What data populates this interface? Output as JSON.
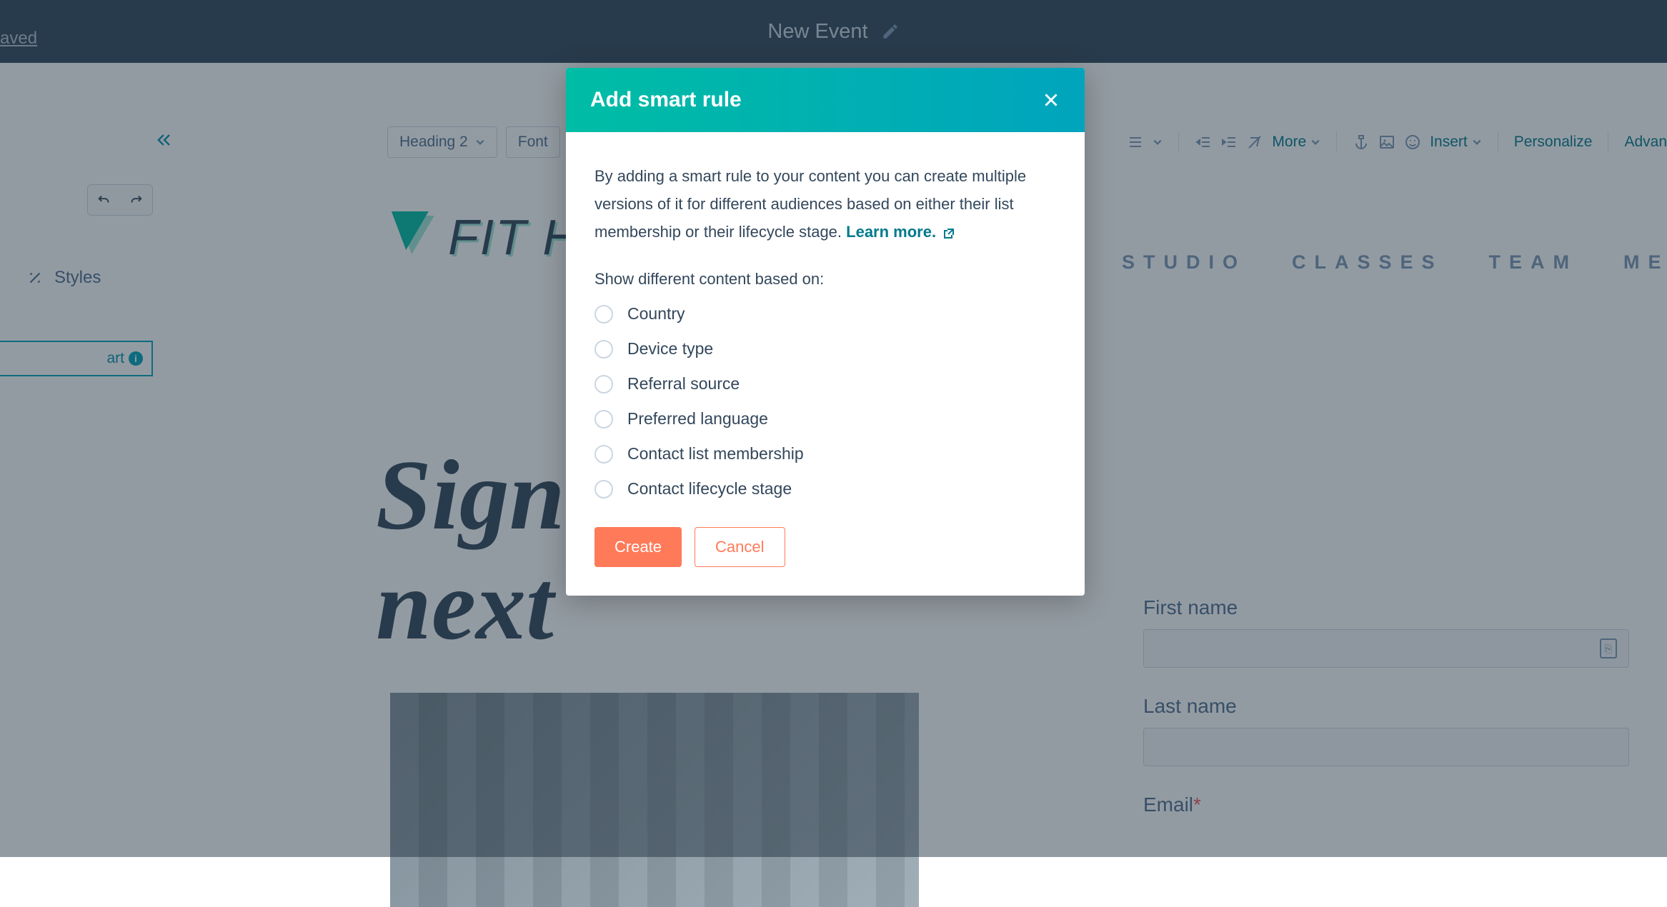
{
  "topbar": {
    "saved_label": "aved",
    "title": "New Event"
  },
  "toolbar": {
    "heading": "Heading 2",
    "font": "Font",
    "more": "More",
    "insert": "Insert",
    "personalize": "Personalize",
    "advanced": "Advan"
  },
  "left_panel": {
    "styles_label": "Styles",
    "smart_label": "art"
  },
  "nav": {
    "items": [
      "STUDIO",
      "CLASSES",
      "TEAM",
      "MEMBERS"
    ]
  },
  "logo": {
    "text": "FIT H"
  },
  "hero": {
    "line1": "Sign",
    "line2": "next"
  },
  "form": {
    "first_name": "First name",
    "last_name": "Last name",
    "email": "Email",
    "required": "*"
  },
  "modal": {
    "title": "Add smart rule",
    "intro": "By adding a smart rule to your content you can create multiple versions of it for different audiences based on either their list membership or their lifecycle stage. ",
    "learn_more": "Learn more.",
    "subhead": "Show different content based on:",
    "options": [
      "Country",
      "Device type",
      "Referral source",
      "Preferred language",
      "Contact list membership",
      "Contact lifecycle stage"
    ],
    "create": "Create",
    "cancel": "Cancel"
  }
}
